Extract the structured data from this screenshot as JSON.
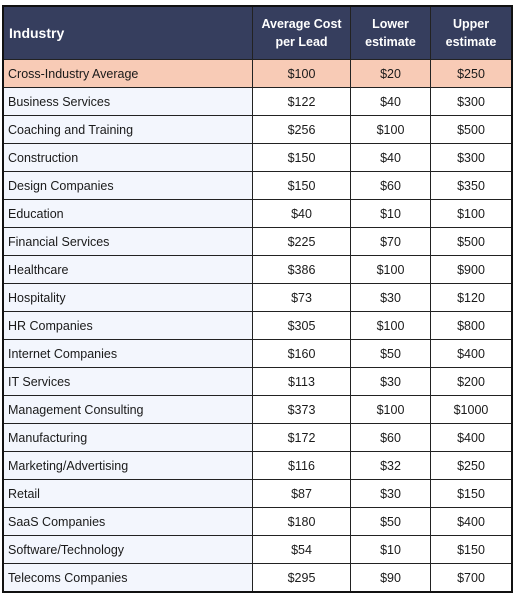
{
  "table": {
    "headers": {
      "industry": "Industry",
      "avg_cost": "Average Cost per Lead",
      "lower": "Lower estimate",
      "upper": "Upper estimate"
    },
    "highlight_color": "#f8cbb6",
    "header_color": "#363e5e",
    "rows": [
      {
        "industry": "Cross-Industry Average",
        "avg": "$100",
        "lower": "$20",
        "upper": "$250"
      },
      {
        "industry": "Business Services",
        "avg": "$122",
        "lower": "$40",
        "upper": "$300"
      },
      {
        "industry": "Coaching and Training",
        "avg": "$256",
        "lower": "$100",
        "upper": "$500"
      },
      {
        "industry": "Construction",
        "avg": "$150",
        "lower": "$40",
        "upper": "$300"
      },
      {
        "industry": "Design Companies",
        "avg": "$150",
        "lower": "$60",
        "upper": "$350"
      },
      {
        "industry": "Education",
        "avg": "$40",
        "lower": "$10",
        "upper": "$100"
      },
      {
        "industry": "Financial Services",
        "avg": "$225",
        "lower": "$70",
        "upper": "$500"
      },
      {
        "industry": "Healthcare",
        "avg": "$386",
        "lower": "$100",
        "upper": "$900"
      },
      {
        "industry": "Hospitality",
        "avg": "$73",
        "lower": "$30",
        "upper": "$120"
      },
      {
        "industry": "HR Companies",
        "avg": "$305",
        "lower": "$100",
        "upper": "$800"
      },
      {
        "industry": "Internet Companies",
        "avg": "$160",
        "lower": "$50",
        "upper": "$400"
      },
      {
        "industry": "IT Services",
        "avg": "$113",
        "lower": "$30",
        "upper": "$200"
      },
      {
        "industry": "Management Consulting",
        "avg": "$373",
        "lower": "$100",
        "upper": "$1000"
      },
      {
        "industry": "Manufacturing",
        "avg": "$172",
        "lower": "$60",
        "upper": "$400"
      },
      {
        "industry": "Marketing/Advertising",
        "avg": "$116",
        "lower": "$32",
        "upper": "$250"
      },
      {
        "industry": "Retail",
        "avg": "$87",
        "lower": "$30",
        "upper": "$150"
      },
      {
        "industry": "SaaS Companies",
        "avg": "$180",
        "lower": "$50",
        "upper": "$400"
      },
      {
        "industry": "Software/Technology",
        "avg": "$54",
        "lower": "$10",
        "upper": "$150"
      },
      {
        "industry": "Telecoms Companies",
        "avg": "$295",
        "lower": "$90",
        "upper": "$700"
      }
    ]
  }
}
